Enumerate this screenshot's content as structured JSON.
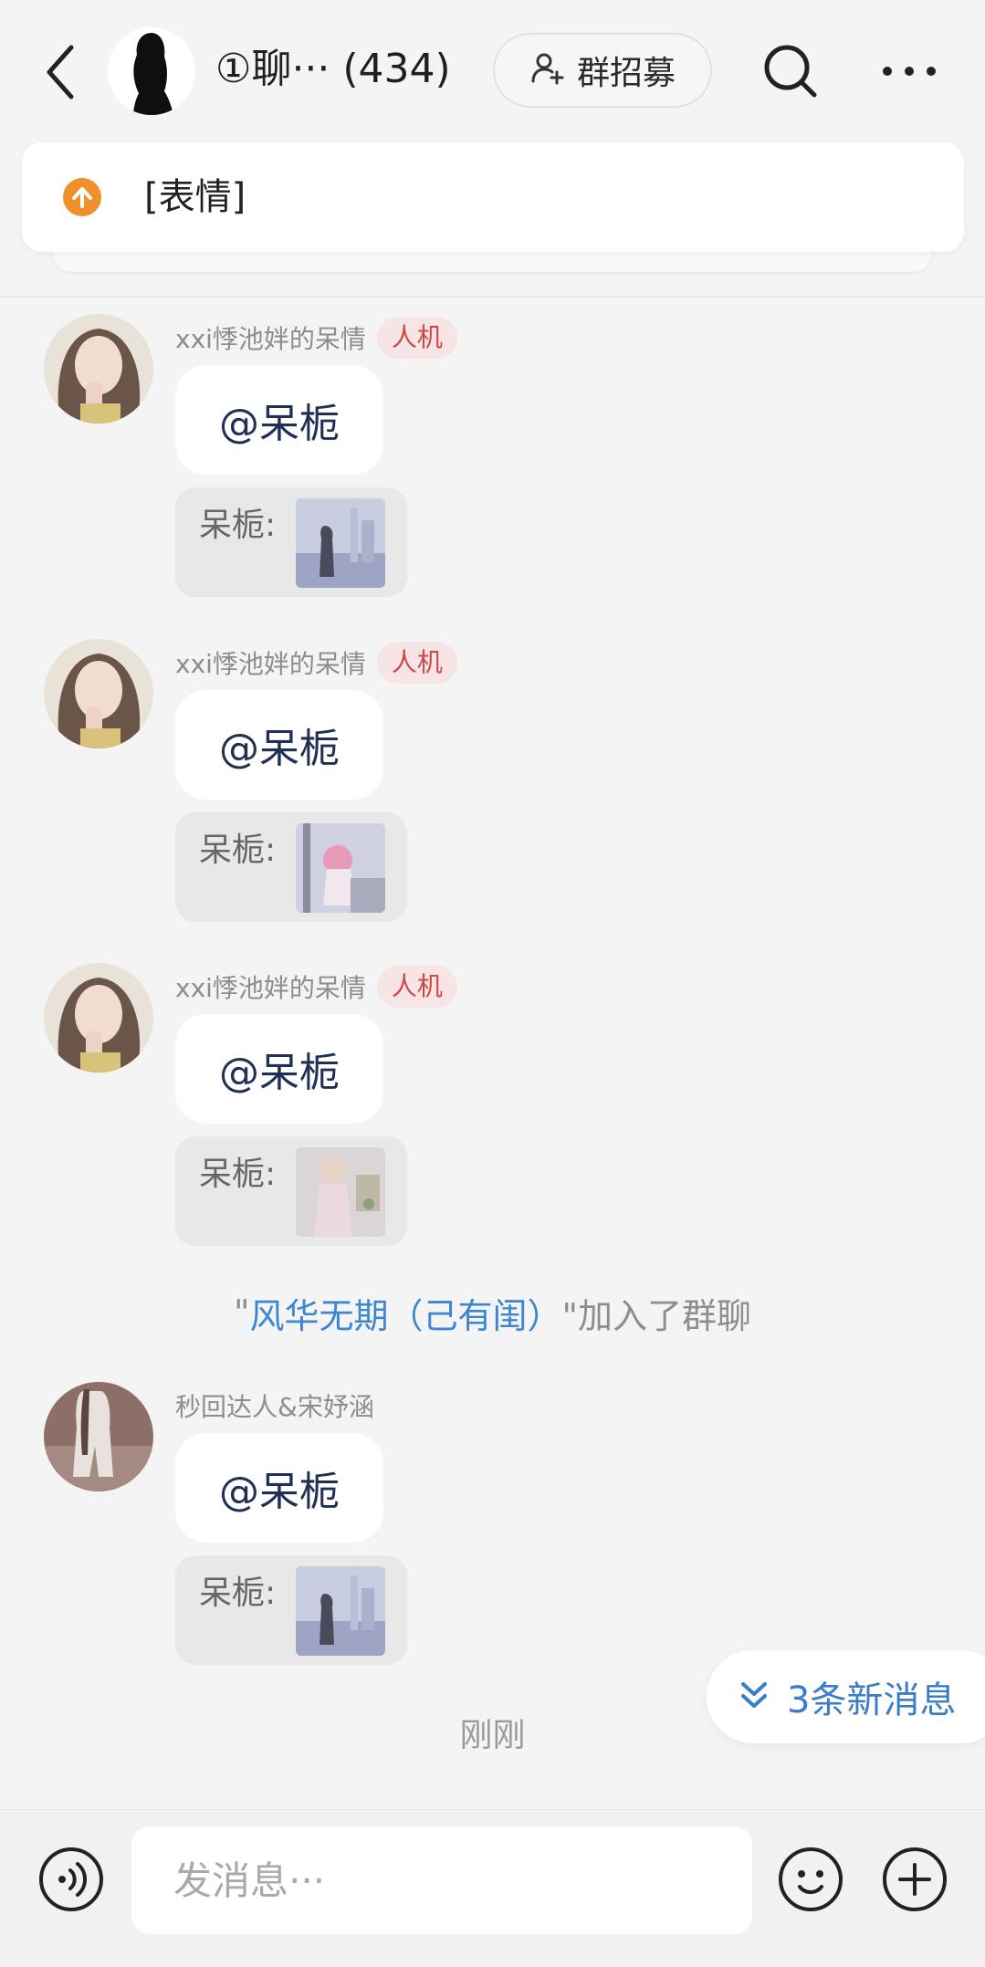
{
  "header": {
    "group_title": "①聊··· (434)",
    "recruit_label": "群招募"
  },
  "pinned": {
    "text": "[表情]"
  },
  "messages": [
    {
      "sender": "xxi悸池姅的呆情",
      "badge": "人机",
      "text": "@呆栀",
      "quote_label": "呆栀:"
    },
    {
      "sender": "xxi悸池姅的呆情",
      "badge": "人机",
      "text": "@呆栀",
      "quote_label": "呆栀:"
    },
    {
      "sender": "xxi悸池姅的呆情",
      "badge": "人机",
      "text": "@呆栀",
      "quote_label": "呆栀:"
    },
    {
      "sender": "秒回达人&宋妤涵",
      "text": "@呆栀",
      "quote_label": "呆栀:"
    }
  ],
  "system": {
    "prefix": "\"",
    "name": "风华无期（己有闺）",
    "suffix": "\"加入了群聊"
  },
  "new_messages": {
    "label": "3条新消息"
  },
  "timestamp": "刚刚",
  "input": {
    "placeholder": "发消息···"
  },
  "colors": {
    "accent_blue": "#3a7dc6",
    "badge_red": "#d04747",
    "notice_orange": "#f0902a"
  }
}
